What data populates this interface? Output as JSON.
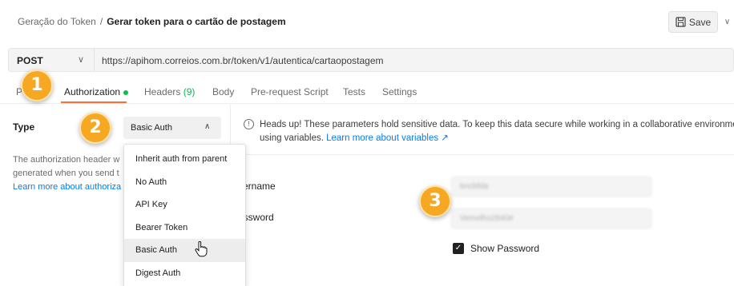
{
  "header": {
    "breadcrumb_parent": "Geração do Token",
    "breadcrumb_sep": "/",
    "breadcrumb_current": "Gerar token para o cartão de postagem",
    "save_label": "Save"
  },
  "request": {
    "method": "POST",
    "url": "https://apihom.correios.com.br/token/v1/autentica/cartaopostagem"
  },
  "tabs": [
    {
      "label": "P"
    },
    {
      "label": "Authorization",
      "active": true
    },
    {
      "label": "Headers",
      "count": "(9)"
    },
    {
      "label": "Body"
    },
    {
      "label": "Pre-request Script"
    },
    {
      "label": "Tests"
    },
    {
      "label": "Settings"
    }
  ],
  "auth": {
    "type_label": "Type",
    "selected_type": "Basic Auth",
    "help_line1": "The authorization header w",
    "help_line2": "generated when you send t",
    "help_link": "Learn more about authoriza",
    "options": [
      "Inherit auth from parent",
      "No Auth",
      "API Key",
      "Bearer Token",
      "Basic Auth",
      "Digest Auth"
    ],
    "hovered_option": "Basic Auth"
  },
  "alert": {
    "icon": "!",
    "line1": "Heads up! These parameters hold sensitive data. To keep this data secure while working in a collaborative environme",
    "line2_text": "using variables. ",
    "line2_link": "Learn more about variables ↗"
  },
  "fields": {
    "username_label": "sername",
    "username_value": "bncbfda",
    "password_label": "assword",
    "password_value": "Vemelho2840#",
    "show_password_label": "Show Password",
    "show_password_checked": true
  },
  "badges": [
    "1",
    "2",
    "3"
  ],
  "colors": {
    "accent": "#ff6c37",
    "link": "#097bed",
    "success": "#0cbb52",
    "badge": "#f7a823"
  }
}
